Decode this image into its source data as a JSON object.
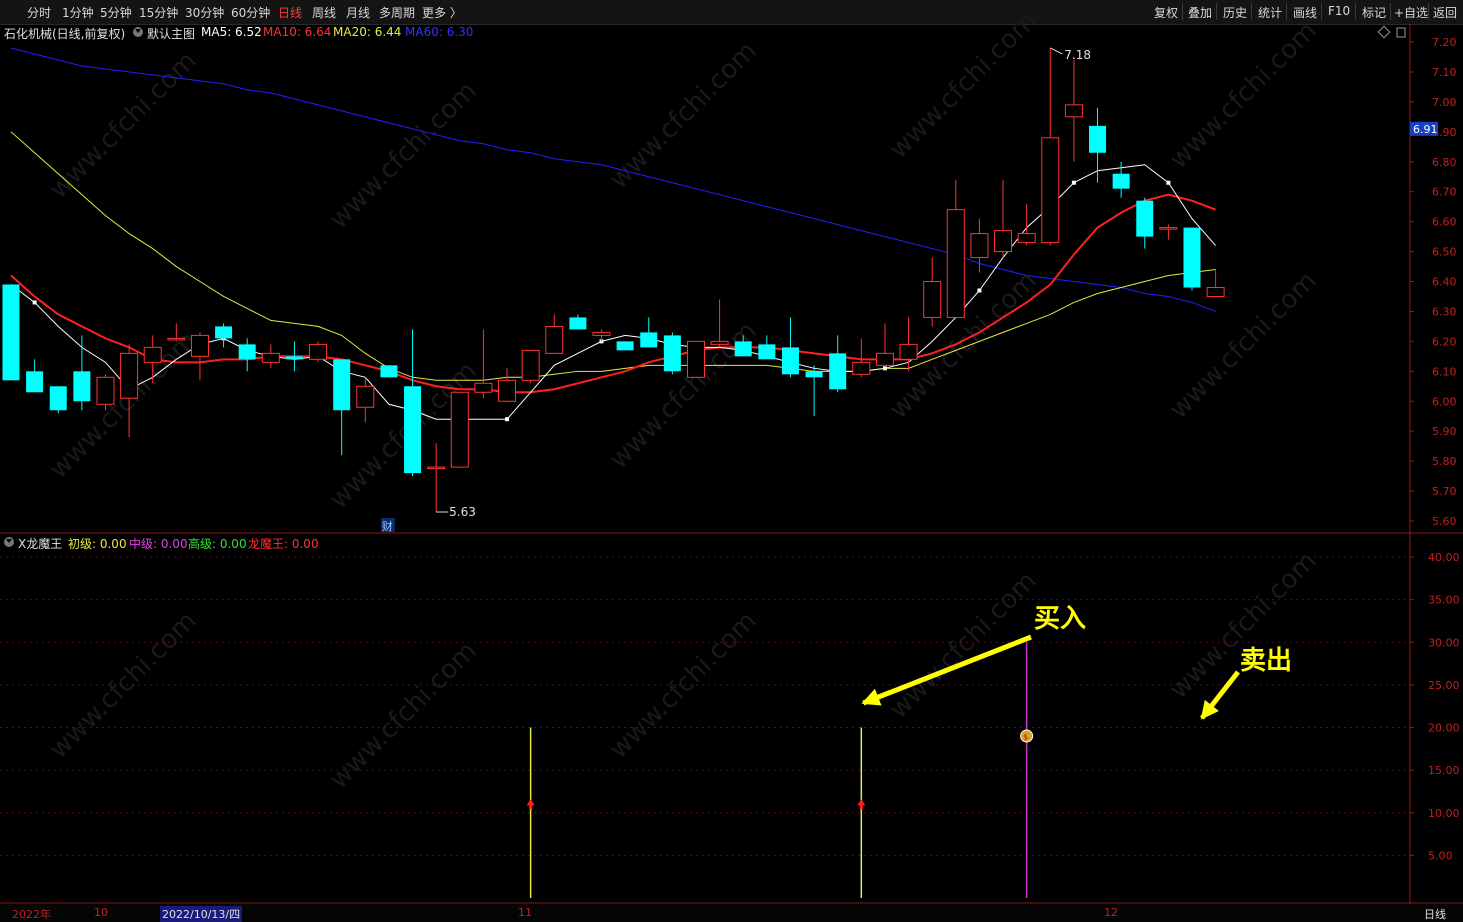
{
  "toolbar": {
    "periods": [
      "分时",
      "1分钟",
      "5分钟",
      "15分钟",
      "30分钟",
      "60分钟",
      "日线",
      "周线",
      "月线",
      "多周期",
      "更多 〉"
    ],
    "active": "日线",
    "right_buttons": [
      "复权",
      "叠加",
      "历史",
      "统计",
      "画线",
      "F10",
      "标记",
      "+自选",
      "返回"
    ]
  },
  "header": {
    "title": "石化机械(日线,前复权)",
    "template": "默认主图",
    "ma5": "MA5: 6.52",
    "ma10": "MA10: 6.64",
    "ma20": "MA20: 6.44",
    "ma60": "MA60: 6.30"
  },
  "price_axis": {
    "ticks": [
      "7.20",
      "7.10",
      "7.00",
      "6.90",
      "6.80",
      "6.70",
      "6.60",
      "6.50",
      "6.40",
      "6.30",
      "6.20",
      "6.10",
      "6.00",
      "5.90",
      "5.80",
      "5.70",
      "5.60"
    ],
    "last_price": "6.91",
    "high_label": "7.18",
    "low_label": "5.63"
  },
  "finance_marker": "财",
  "indicator": {
    "name": "X龙魔王",
    "chuji": "初级: 0.00",
    "zhongji": "中级: 0.00",
    "gaoji": "高级: 0.00",
    "longmowang": "龙魔王: 0.00",
    "ticks": [
      "40.00",
      "35.00",
      "30.00",
      "25.00",
      "20.00",
      "15.00",
      "10.00",
      "5.00"
    ],
    "buy_label": "买入",
    "sell_label": "卖出"
  },
  "colors": {
    "up": "#ff3333",
    "down": "#00ffff",
    "ma5": "#ffffff",
    "ma10": "#ff2020",
    "ma20": "#e8e840",
    "ma60": "#2020ff",
    "annotation": "#ffff00"
  },
  "chart_data": {
    "type": "candlestick",
    "ylim": [
      5.6,
      7.2
    ],
    "candles": [
      {
        "o": 6.39,
        "h": 6.39,
        "l": 6.07,
        "c": 6.07
      },
      {
        "o": 6.1,
        "h": 6.14,
        "l": 6.03,
        "c": 6.03
      },
      {
        "o": 6.05,
        "h": 6.05,
        "l": 5.96,
        "c": 5.97
      },
      {
        "o": 6.1,
        "h": 6.22,
        "l": 5.97,
        "c": 6.0
      },
      {
        "o": 5.99,
        "h": 6.09,
        "l": 5.97,
        "c": 6.08
      },
      {
        "o": 6.01,
        "h": 6.19,
        "l": 5.88,
        "c": 6.16
      },
      {
        "o": 6.13,
        "h": 6.22,
        "l": 6.06,
        "c": 6.18
      },
      {
        "o": 6.21,
        "h": 6.26,
        "l": 6.2,
        "c": 6.21
      },
      {
        "o": 6.15,
        "h": 6.23,
        "l": 6.07,
        "c": 6.22
      },
      {
        "o": 6.25,
        "h": 6.26,
        "l": 6.18,
        "c": 6.21
      },
      {
        "o": 6.19,
        "h": 6.21,
        "l": 6.1,
        "c": 6.14
      },
      {
        "o": 6.13,
        "h": 6.19,
        "l": 6.11,
        "c": 6.16
      },
      {
        "o": 6.15,
        "h": 6.2,
        "l": 6.1,
        "c": 6.14
      },
      {
        "o": 6.14,
        "h": 6.2,
        "l": 6.13,
        "c": 6.19
      },
      {
        "o": 6.14,
        "h": 6.14,
        "l": 5.82,
        "c": 5.97
      },
      {
        "o": 5.98,
        "h": 6.08,
        "l": 5.93,
        "c": 6.05
      },
      {
        "o": 6.12,
        "h": 6.12,
        "l": 6.08,
        "c": 6.08
      },
      {
        "o": 6.05,
        "h": 6.24,
        "l": 5.75,
        "c": 5.76
      },
      {
        "o": 5.78,
        "h": 5.86,
        "l": 5.63,
        "c": 5.78
      },
      {
        "o": 5.78,
        "h": 6.03,
        "l": 5.78,
        "c": 6.03
      },
      {
        "o": 6.03,
        "h": 6.24,
        "l": 6.01,
        "c": 6.06
      },
      {
        "o": 6.0,
        "h": 6.11,
        "l": 6.0,
        "c": 6.07
      },
      {
        "o": 6.07,
        "h": 6.17,
        "l": 6.06,
        "c": 6.17
      },
      {
        "o": 6.16,
        "h": 6.29,
        "l": 6.16,
        "c": 6.25
      },
      {
        "o": 6.28,
        "h": 6.29,
        "l": 6.24,
        "c": 6.24
      },
      {
        "o": 6.22,
        "h": 6.24,
        "l": 6.2,
        "c": 6.23
      },
      {
        "o": 6.2,
        "h": 6.2,
        "l": 6.17,
        "c": 6.17
      },
      {
        "o": 6.23,
        "h": 6.28,
        "l": 6.18,
        "c": 6.18
      },
      {
        "o": 6.22,
        "h": 6.23,
        "l": 6.09,
        "c": 6.1
      },
      {
        "o": 6.08,
        "h": 6.2,
        "l": 6.08,
        "c": 6.2
      },
      {
        "o": 6.19,
        "h": 6.34,
        "l": 6.18,
        "c": 6.2
      },
      {
        "o": 6.2,
        "h": 6.22,
        "l": 6.16,
        "c": 6.15
      },
      {
        "o": 6.19,
        "h": 6.22,
        "l": 6.14,
        "c": 6.14
      },
      {
        "o": 6.18,
        "h": 6.28,
        "l": 6.08,
        "c": 6.09
      },
      {
        "o": 6.1,
        "h": 6.12,
        "l": 5.95,
        "c": 6.08
      },
      {
        "o": 6.16,
        "h": 6.22,
        "l": 6.03,
        "c": 6.04
      },
      {
        "o": 6.09,
        "h": 6.21,
        "l": 6.08,
        "c": 6.13
      },
      {
        "o": 6.12,
        "h": 6.26,
        "l": 6.12,
        "c": 6.16
      },
      {
        "o": 6.14,
        "h": 6.28,
        "l": 6.1,
        "c": 6.19
      },
      {
        "o": 6.28,
        "h": 6.48,
        "l": 6.25,
        "c": 6.4
      },
      {
        "o": 6.28,
        "h": 6.74,
        "l": 6.28,
        "c": 6.64
      },
      {
        "o": 6.48,
        "h": 6.61,
        "l": 6.43,
        "c": 6.56
      },
      {
        "o": 6.5,
        "h": 6.74,
        "l": 6.48,
        "c": 6.57
      },
      {
        "o": 6.53,
        "h": 6.66,
        "l": 6.52,
        "c": 6.56
      },
      {
        "o": 6.53,
        "h": 7.18,
        "l": 6.52,
        "c": 6.88
      },
      {
        "o": 6.95,
        "h": 7.14,
        "l": 6.8,
        "c": 6.99
      },
      {
        "o": 6.92,
        "h": 6.98,
        "l": 6.73,
        "c": 6.83
      },
      {
        "o": 6.76,
        "h": 6.8,
        "l": 6.68,
        "c": 6.71
      },
      {
        "o": 6.67,
        "h": 6.68,
        "l": 6.51,
        "c": 6.55
      },
      {
        "o": 6.58,
        "h": 6.59,
        "l": 6.54,
        "c": 6.58
      },
      {
        "o": 6.58,
        "h": 6.58,
        "l": 6.37,
        "c": 6.38
      },
      {
        "o": 6.35,
        "h": 6.44,
        "l": 6.35,
        "c": 6.38
      }
    ],
    "ma5": [
      6.39,
      6.33,
      6.25,
      6.18,
      6.13,
      6.04,
      6.08,
      6.14,
      6.19,
      6.21,
      6.17,
      6.15,
      6.14,
      6.15,
      6.1,
      6.08,
      5.99,
      5.97,
      5.94,
      5.94,
      5.94,
      5.94,
      6.03,
      6.12,
      6.16,
      6.2,
      6.22,
      6.21,
      6.19,
      6.18,
      6.18,
      6.17,
      6.15,
      6.13,
      6.11,
      6.1,
      6.1,
      6.11,
      6.13,
      6.2,
      6.28,
      6.37,
      6.48,
      6.58,
      6.65,
      6.73,
      6.77,
      6.78,
      6.79,
      6.73,
      6.61,
      6.52
    ],
    "ma10": [
      6.42,
      6.35,
      6.29,
      6.25,
      6.21,
      6.18,
      6.14,
      6.13,
      6.13,
      6.14,
      6.14,
      6.15,
      6.15,
      6.15,
      6.14,
      6.12,
      6.1,
      6.07,
      6.05,
      6.04,
      6.04,
      6.03,
      6.03,
      6.04,
      6.06,
      6.08,
      6.1,
      6.13,
      6.15,
      6.17,
      6.18,
      6.18,
      6.18,
      6.17,
      6.16,
      6.15,
      6.14,
      6.14,
      6.14,
      6.16,
      6.19,
      6.23,
      6.28,
      6.33,
      6.39,
      6.49,
      6.58,
      6.63,
      6.67,
      6.69,
      6.67,
      6.64
    ],
    "ma20": [
      6.9,
      6.83,
      6.76,
      6.69,
      6.62,
      6.56,
      6.51,
      6.45,
      6.4,
      6.35,
      6.31,
      6.27,
      6.26,
      6.25,
      6.22,
      6.16,
      6.11,
      6.08,
      6.07,
      6.07,
      6.07,
      6.08,
      6.08,
      6.09,
      6.1,
      6.1,
      6.11,
      6.12,
      6.12,
      6.12,
      6.12,
      6.12,
      6.12,
      6.11,
      6.1,
      6.1,
      6.1,
      6.11,
      6.11,
      6.14,
      6.17,
      6.2,
      6.23,
      6.26,
      6.29,
      6.33,
      6.36,
      6.38,
      6.4,
      6.42,
      6.43,
      6.44
    ],
    "ma60": [
      7.18,
      7.16,
      7.14,
      7.12,
      7.11,
      7.1,
      7.09,
      7.08,
      7.07,
      7.06,
      7.04,
      7.03,
      7.01,
      6.99,
      6.97,
      6.95,
      6.93,
      6.91,
      6.89,
      6.87,
      6.86,
      6.84,
      6.83,
      6.81,
      6.8,
      6.79,
      6.77,
      6.75,
      6.73,
      6.71,
      6.69,
      6.67,
      6.65,
      6.63,
      6.61,
      6.59,
      6.57,
      6.55,
      6.53,
      6.51,
      6.49,
      6.46,
      6.44,
      6.42,
      6.41,
      6.4,
      6.39,
      6.38,
      6.36,
      6.35,
      6.33,
      6.3
    ],
    "indicator_ylim": [
      0,
      42
    ],
    "signals": [
      {
        "index": 22,
        "color": "#e8e840",
        "top": 20,
        "marker": "up-arrow",
        "marker_y": 11
      },
      {
        "index": 36,
        "color": "#e8e840",
        "top": 20,
        "marker": "up-arrow",
        "marker_y": 11
      },
      {
        "index": 43,
        "color": "#cc33cc",
        "top": 30,
        "marker": "moneybag",
        "marker_y": 19
      }
    ],
    "x_labels": [
      "2022年",
      "10",
      "2022/10/13/四",
      "11",
      "12"
    ],
    "period_label": "日线"
  }
}
